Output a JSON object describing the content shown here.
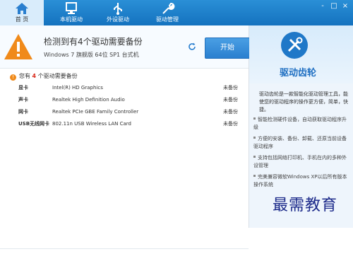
{
  "nav": {
    "tabs": [
      {
        "label": "首 页",
        "icon": "home-icon",
        "active": true
      },
      {
        "label": "本机驱动",
        "icon": "computer-icon",
        "active": false
      },
      {
        "label": "外设驱动",
        "icon": "usb-icon",
        "active": false
      },
      {
        "label": "驱动管理",
        "icon": "wrench-icon",
        "active": false
      }
    ],
    "window_controls": [
      "-",
      "□",
      "×"
    ]
  },
  "banner": {
    "title": "检测到有4个驱动需要备份",
    "system": "Windows 7 旗舰版  64位 SP1 台式机",
    "start_label": "开始"
  },
  "summary": {
    "prefix": "您有 ",
    "count": "4",
    "suffix": " 个驱动需要备份"
  },
  "drivers": [
    {
      "type": "显卡",
      "name": "Intel(R) HD Graphics",
      "status": "未备份"
    },
    {
      "type": "声卡",
      "name": "Realtek High Definition Audio",
      "status": "未备份"
    },
    {
      "type": "网卡",
      "name": "Realtek PCIe GBE Family Controller",
      "status": "未备份"
    },
    {
      "type": "USB无线网卡",
      "name": "802.11n USB Wireless LAN Card",
      "status": "未备份"
    }
  ],
  "side": {
    "brand": "驱动齿轮",
    "description": "驱动齿轮是一款智能化驱动管理工具，能使您的驱动程序的操作更方便，简单，快捷。",
    "features": [
      "智能检测硬件设备，自动获取驱动程序升级",
      "方便的安装、备份、卸载、还原当前设备驱动程序",
      "支持包括网络打印机、手机在内的多种外设管理",
      "完美兼容微软Windows XP以后所有版本操作系统"
    ]
  },
  "watermark": "最需教育",
  "colors": {
    "accent": "#1f78c8",
    "warning": "#f08a1a",
    "count_red": "#d92b1c"
  }
}
